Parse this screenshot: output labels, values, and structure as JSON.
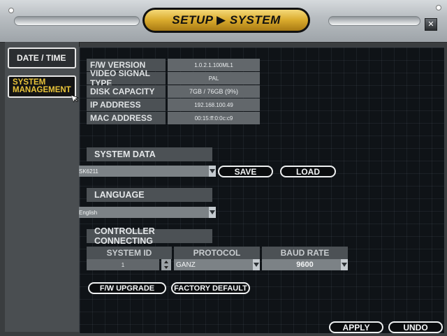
{
  "title": "SETUP ▶ SYSTEM",
  "close_glyph": "✕",
  "sidebar": {
    "items": [
      {
        "label": "DATE / TIME"
      },
      {
        "label_line1": "SYSTEM",
        "label_line2": "MANAGEMENT"
      }
    ]
  },
  "info": {
    "rows": [
      {
        "label": "F/W VERSION",
        "value": "1.0.2.1.100ML1"
      },
      {
        "label": "VIDEO SIGNAL TYPE",
        "value": "PAL"
      },
      {
        "label": "DISK CAPACITY",
        "value": "7GB  /  76GB  (9%)"
      },
      {
        "label": "IP ADDRESS",
        "value": "192.168.100.49"
      },
      {
        "label": "MAC ADDRESS",
        "value": "00:15:ff:0:0c:c9"
      }
    ]
  },
  "system_data": {
    "heading": "SYSTEM DATA",
    "selected": "SK6211",
    "save_label": "SAVE",
    "load_label": "LOAD"
  },
  "language": {
    "heading": "LANGUAGE",
    "selected": "English"
  },
  "controller": {
    "heading": "CONTROLLER CONNECTING",
    "headers": [
      "SYSTEM ID",
      "PROTOCOL",
      "BAUD RATE"
    ],
    "system_id": "1",
    "protocol": "GANZ",
    "baud_rate": "9600"
  },
  "buttons": {
    "fw_upgrade": "F/W UPGRADE",
    "factory_default": "FACTORY DEFAULT",
    "apply": "APPLY",
    "undo": "UNDO"
  },
  "colors": {
    "accent_gold": "#e8c33a",
    "panel_bg": "#0f1317",
    "field_bg": "#4c5155"
  }
}
